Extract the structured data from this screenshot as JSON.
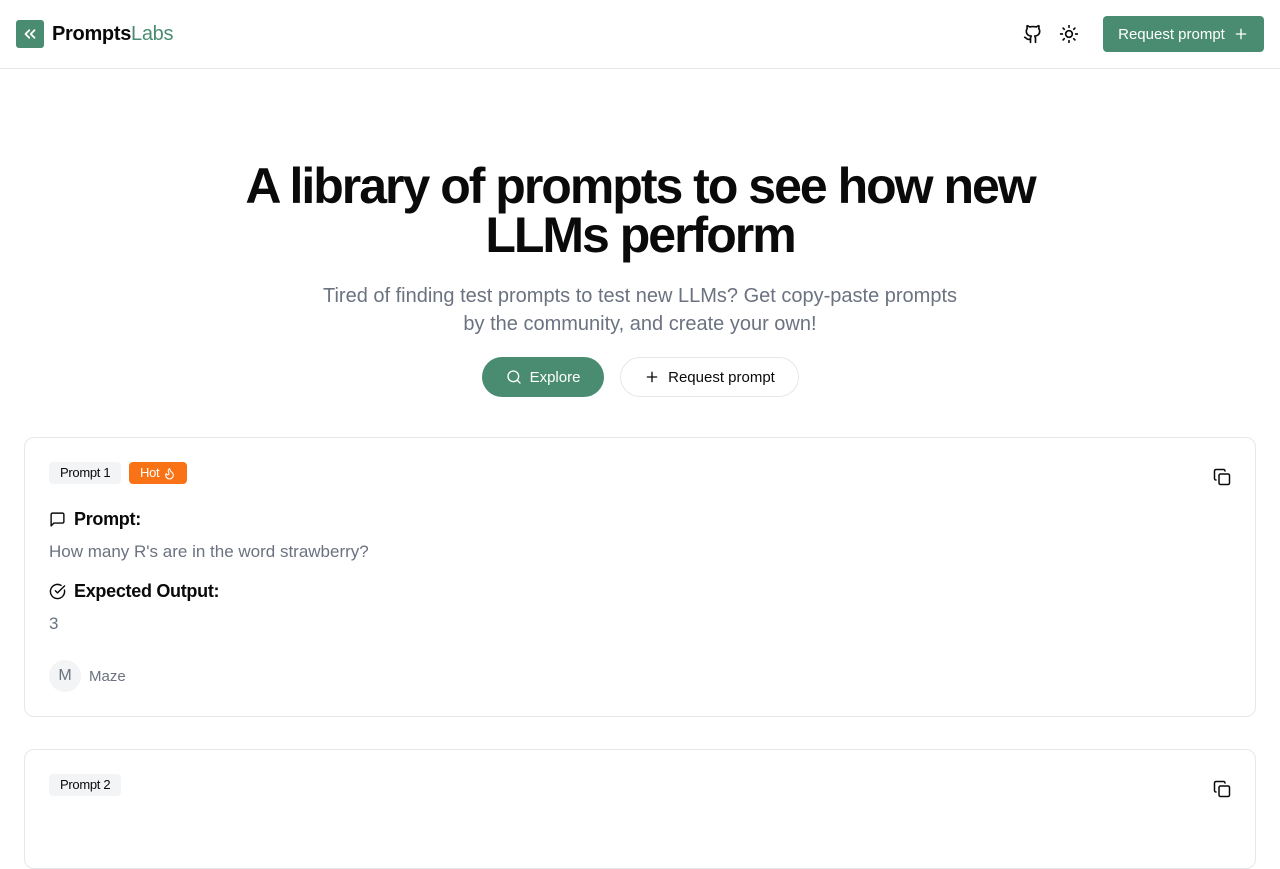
{
  "header": {
    "brand_part1": "Prompts",
    "brand_part2": "Labs",
    "request_button_label": "Request prompt"
  },
  "hero": {
    "title": "A library of prompts to see how new LLMs perform",
    "subtitle": "Tired of finding test prompts to test new LLMs? Get copy-paste prompts by the community, and create your own!",
    "explore_label": "Explore",
    "request_label": "Request prompt"
  },
  "prompts": [
    {
      "badge": "Prompt 1",
      "hot_badge": "Hot",
      "prompt_label": "Prompt:",
      "prompt_text": "How many R's are in the word strawberry?",
      "expected_label": "Expected Output:",
      "expected_text": "3",
      "author_initial": "M",
      "author_name": "Maze"
    },
    {
      "badge": "Prompt 2"
    }
  ],
  "colors": {
    "accent": "#4a8c72",
    "hot": "#f97316",
    "muted_text": "#6b7280",
    "border": "#e5e7eb"
  },
  "icons": {
    "logo": "chevrons-left-icon",
    "github": "github-icon",
    "theme": "sun-icon",
    "plus": "plus-icon",
    "search": "search-icon",
    "flame": "flame-icon",
    "copy": "copy-icon",
    "message": "message-square-icon",
    "check": "circle-check-icon"
  }
}
